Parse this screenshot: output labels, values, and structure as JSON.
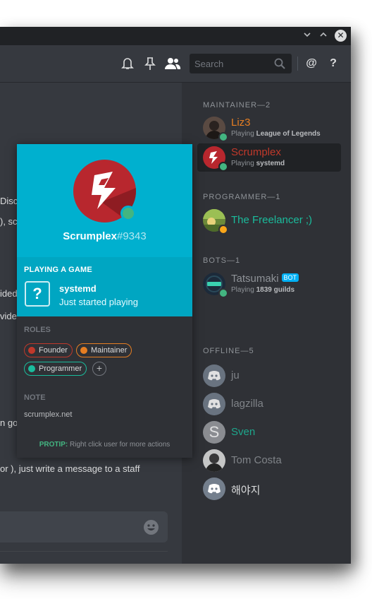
{
  "header": {
    "search_placeholder": "Search",
    "mention_label": "@",
    "help_label": "?"
  },
  "chat": {
    "fragments": [
      "Disc",
      "), sc",
      "ided",
      "vide",
      "n go",
      "or ), just write a message to a staff"
    ]
  },
  "popout": {
    "username": "Scrumplex",
    "discriminator": "#9343",
    "activity_heading": "PLAYING A GAME",
    "game_name": "systemd",
    "game_detail": "Just started playing",
    "roles_heading": "ROLES",
    "roles": [
      {
        "label": "Founder",
        "color": "#c0392b"
      },
      {
        "label": "Maintainer",
        "color": "#e67e22"
      },
      {
        "label": "Programmer",
        "color": "#1abc9c"
      }
    ],
    "note_heading": "NOTE",
    "note": "scrumplex.net",
    "protip_label": "PROTIP:",
    "protip_text": "Right click user for more actions"
  },
  "members": {
    "sections": [
      {
        "title": "MAINTAINER—2"
      },
      {
        "title": "PROGRAMMER—1"
      },
      {
        "title": "BOTS—1"
      },
      {
        "title": "OFFLINE—5"
      }
    ],
    "maintainers": [
      {
        "name": "Liz3",
        "playing_prefix": "Playing",
        "game": "League of Legends",
        "color": "#e67e22"
      },
      {
        "name": "Scrumplex",
        "playing_prefix": "Playing",
        "game": "systemd",
        "color": "#c0392b"
      }
    ],
    "programmers": [
      {
        "name": "The Freelancer ;)",
        "color": "#1abc9c"
      }
    ],
    "bots": [
      {
        "name": "Tatsumaki",
        "tag": "BOT",
        "playing_prefix": "Playing",
        "game": "1839 guilds",
        "color": "#8e9297"
      }
    ],
    "offline": [
      {
        "name": "ju",
        "color": "#8e9297"
      },
      {
        "name": "lagzilla",
        "color": "#8e9297"
      },
      {
        "name": "Sven",
        "color": "#1abc9c"
      },
      {
        "name": "Tom Costa",
        "color": "#8e9297"
      },
      {
        "name": "해야지",
        "color": "#dcddde"
      }
    ]
  }
}
